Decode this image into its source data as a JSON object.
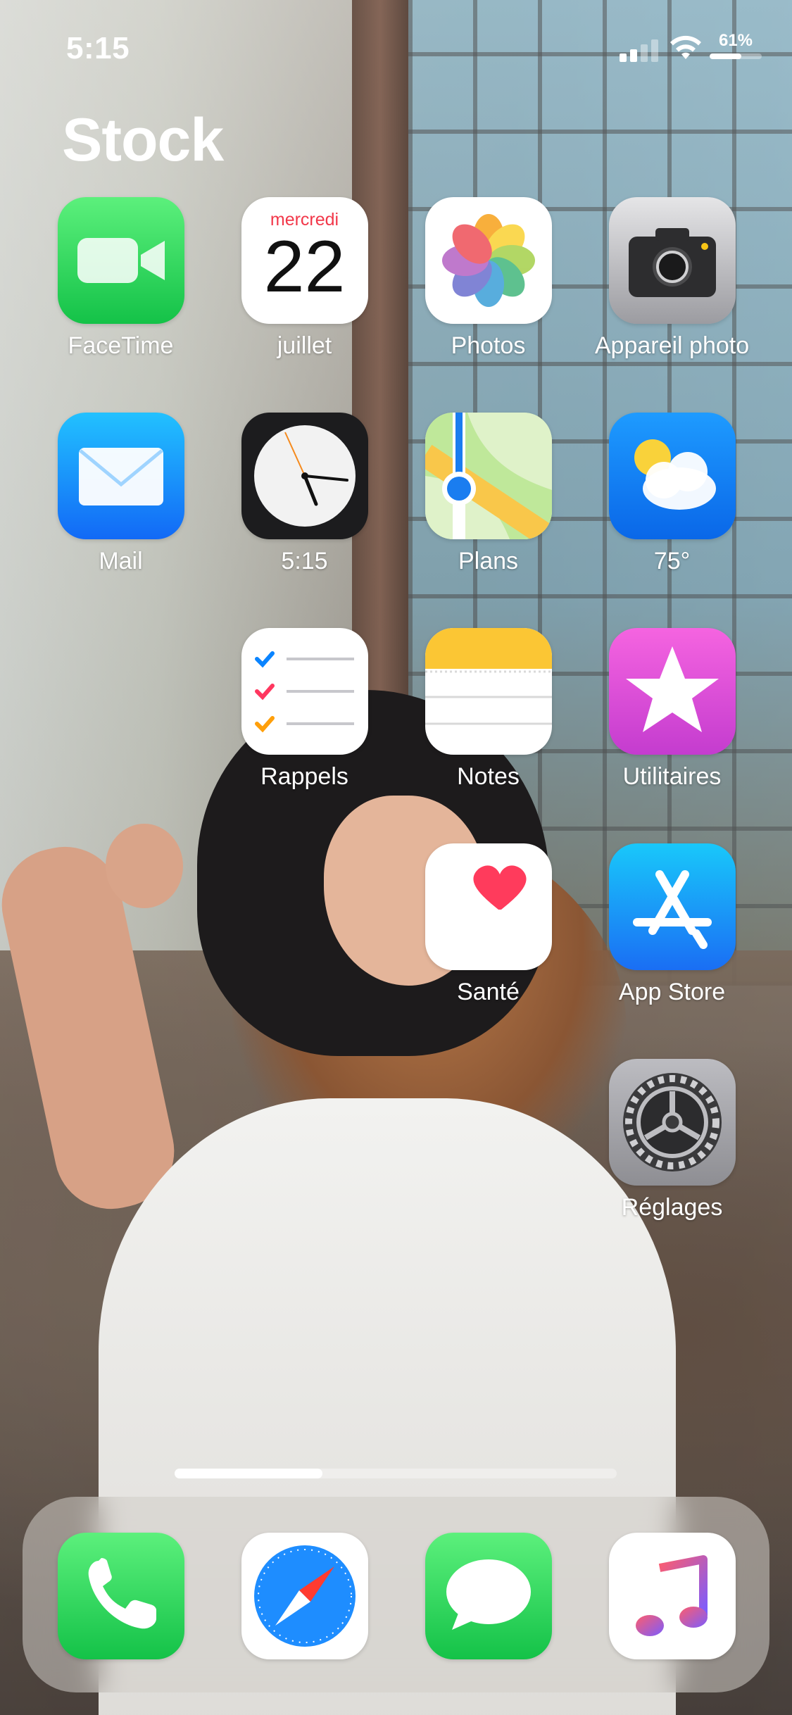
{
  "status_bar": {
    "time": "5:15",
    "battery_percent": "61%",
    "battery_level": 0.61,
    "icons": [
      "cellular-signal-icon",
      "wifi-icon",
      "battery-icon"
    ]
  },
  "page": {
    "title": "Stock"
  },
  "apps": [
    {
      "label": "FaceTime",
      "icon": "facetime-icon"
    },
    {
      "label": "juillet",
      "icon": "calendar-icon",
      "widget_day": "mercredi",
      "widget_date": "22"
    },
    {
      "label": "Photos",
      "icon": "photos-icon"
    },
    {
      "label": "Appareil photo",
      "icon": "camera-icon"
    },
    {
      "label": "Mail",
      "icon": "mail-icon"
    },
    {
      "label": "5:15",
      "icon": "clock-icon"
    },
    {
      "label": "Plans",
      "icon": "maps-icon"
    },
    {
      "label": "75°",
      "icon": "weather-icon"
    },
    {
      "label": "Rappels",
      "icon": "reminders-icon"
    },
    {
      "label": "Notes",
      "icon": "notes-icon"
    },
    {
      "label": "Utilitaires",
      "icon": "utilities-icon"
    },
    {
      "label": "Santé",
      "icon": "health-icon"
    },
    {
      "label": "App Store",
      "icon": "app-store-icon"
    },
    {
      "label": "Réglages",
      "icon": "settings-icon"
    }
  ],
  "dock": [
    {
      "icon": "phone-icon"
    },
    {
      "icon": "safari-icon"
    },
    {
      "icon": "messages-icon"
    },
    {
      "icon": "music-icon"
    }
  ],
  "colors": {
    "calendar_day": "#f2384a",
    "facetime_green": "#14c248",
    "mail_blue": "#1269f6",
    "utilities_pink": "#c43ccf"
  }
}
